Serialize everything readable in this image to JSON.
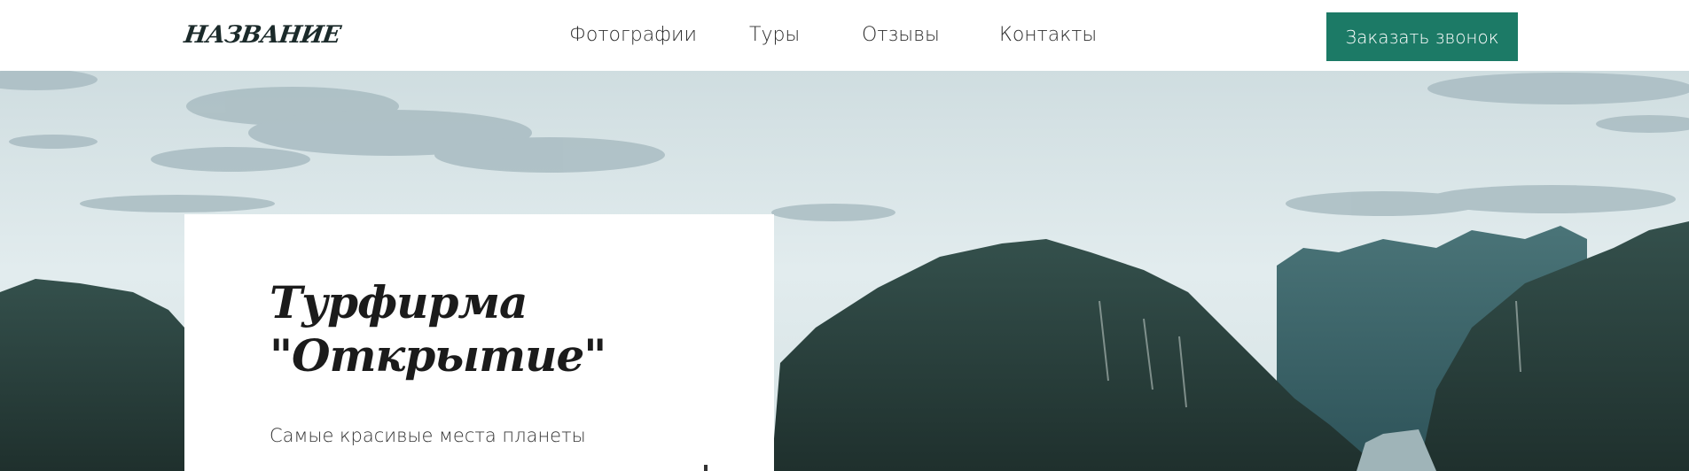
{
  "header": {
    "logo": "НАЗВАНИЕ",
    "nav": [
      {
        "label": "Фотографии"
      },
      {
        "label": "Туры"
      },
      {
        "label": "Отзывы"
      },
      {
        "label": "Контакты"
      }
    ],
    "cta_label": "Заказать звонок"
  },
  "hero": {
    "title_line1": "Турфирма",
    "title_line2": "\"Открытие\"",
    "subtitle": "Самые красивые места планеты",
    "background": "sky-and-karst-mountains-photo"
  },
  "colors": {
    "accent": "#1c7a66",
    "text_dark": "#1b1b1b",
    "sky": "#dde8ea",
    "mountain": "#2a3d3a"
  }
}
